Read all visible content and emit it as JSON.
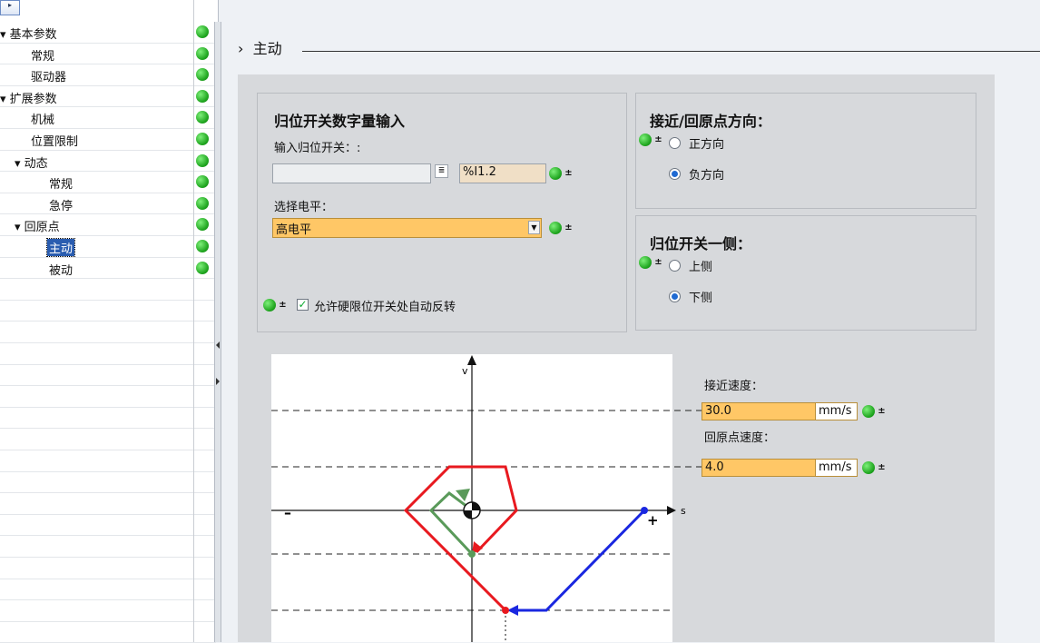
{
  "nav": {
    "items": [
      {
        "label": "▾ 基本参数",
        "indent": 0
      },
      {
        "label": "常规",
        "indent": 34
      },
      {
        "label": "驱动器",
        "indent": 34
      },
      {
        "label": "▾ 扩展参数",
        "indent": 0
      },
      {
        "label": "机械",
        "indent": 34
      },
      {
        "label": "位置限制",
        "indent": 34
      },
      {
        "label": "▾ 动态",
        "indent": 16
      },
      {
        "label": "常规",
        "indent": 54
      },
      {
        "label": "急停",
        "indent": 54
      },
      {
        "label": "▾ 回原点",
        "indent": 16
      },
      {
        "label": "主动",
        "indent": 52,
        "selected": true
      },
      {
        "label": "被动",
        "indent": 54
      }
    ],
    "status_color": "#1fa51f"
  },
  "section": {
    "arrow": "›",
    "title": "主动"
  },
  "homing_input": {
    "title": "归位开关数字量输入",
    "input_label": "输入归位开关：:",
    "input_value": "",
    "address": "%I1.2",
    "level_label": "选择电平：",
    "level_value": "高电平",
    "auto_reverse_label": "允许硬限位开关处自动反转",
    "auto_reverse_checked": true
  },
  "direction": {
    "title": "接近/回原点方向：",
    "options": [
      "正方向",
      "负方向"
    ],
    "selected": "负方向"
  },
  "switch_side": {
    "title": "归位开关一侧：",
    "options": [
      "上侧",
      "下侧"
    ],
    "selected": "下侧"
  },
  "speeds": {
    "approach_label": "接近速度：",
    "approach_value": "30.0",
    "approach_unit": "mm/s",
    "homing_label": "回原点速度：",
    "homing_value": "4.0",
    "homing_unit": "mm/s"
  },
  "diagram": {
    "v_label": "v",
    "s_label": "s",
    "minus": "–",
    "plus": "+"
  },
  "colors": {
    "accent_field": "#ffc766",
    "address_field": "#f0dfc6",
    "red": "#e8191f",
    "blue": "#1a27e0",
    "green": "#5a9a5a"
  },
  "icons": {
    "status": "green-status-dot-icon",
    "download": "download-arrow-icon",
    "browse": "browse-icon",
    "dropdown": "chevron-down-icon",
    "reference_mark": "reference-mark-icon"
  }
}
